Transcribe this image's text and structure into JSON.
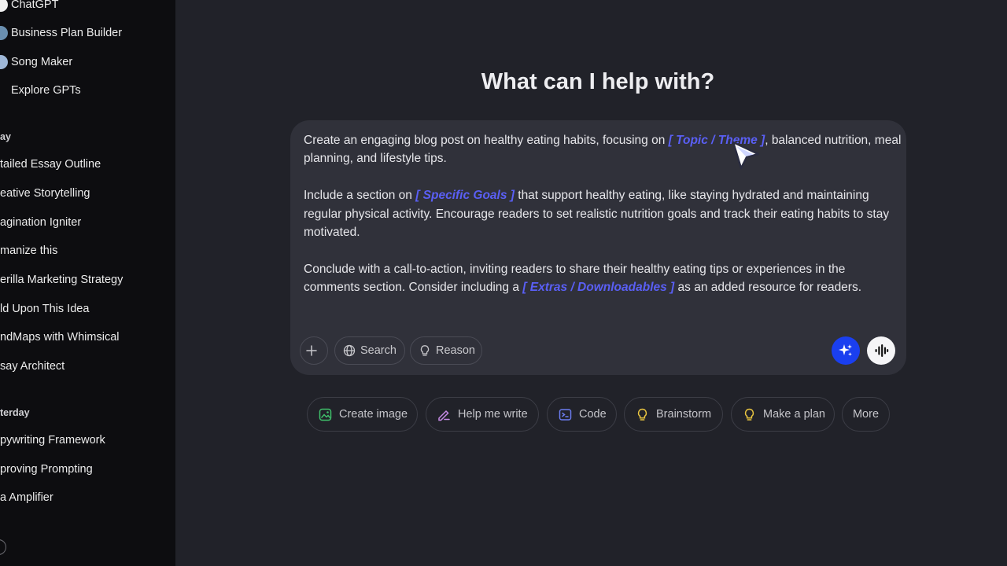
{
  "sidebar": {
    "gpts": [
      {
        "label": "ChatGPT",
        "color": "#f0f0f0"
      },
      {
        "label": "Business Plan Builder",
        "color": "#6a8fb0"
      },
      {
        "label": "Song Maker",
        "color": "#9fb8d8"
      },
      {
        "label": "Explore GPTs",
        "color": ""
      }
    ],
    "today_label": "ay",
    "today_items": [
      "tailed Essay Outline",
      "eative Storytelling",
      "agination Igniter",
      "manize this",
      "erilla Marketing Strategy",
      "ld Upon This Idea",
      "ndMaps with Whimsical",
      "say Architect"
    ],
    "yesterday_label": "terday",
    "yesterday_items": [
      "pywriting Framework",
      "proving Prompting",
      "a Amplifier"
    ]
  },
  "main": {
    "title": "What can I help with?",
    "prompt": {
      "p1_a": "Create an engaging blog post on healthy eating habits, focusing on ",
      "p1_var": "[ Topic / Theme ]",
      "p1_b": ", balanced nutrition, meal planning, and lifestyle tips.",
      "p2_a": "Include a section on ",
      "p2_var": "[ Specific Goals ]",
      "p2_b": " that support healthy eating, like staying hydrated and maintaining regular physical activity. Encourage readers to set realistic nutrition goals and track their eating habits to stay motivated.",
      "p3_a": "Conclude with a call-to-action, inviting readers to share their healthy eating tips or experiences in the comments section. Consider including a ",
      "p3_var": "[ Extras / Downloadables ]",
      "p3_b": " as an added resource for readers."
    },
    "tools": {
      "search_label": "Search",
      "reason_label": "Reason"
    },
    "suggestions": [
      {
        "label": "Create image",
        "icon": "image-icon",
        "color": "#3fbf6a"
      },
      {
        "label": "Help me write",
        "icon": "pen-icon",
        "color": "#c68ae6"
      },
      {
        "label": "Code",
        "icon": "terminal-icon",
        "color": "#6b7cf0"
      },
      {
        "label": "Brainstorm",
        "icon": "bulb-icon",
        "color": "#e8c440"
      },
      {
        "label": "Make a plan",
        "icon": "bulb-icon",
        "color": "#e8c440"
      },
      {
        "label": "More",
        "icon": "",
        "color": ""
      }
    ],
    "accent": "#1a3ff0",
    "variable_color": "#5a5ff5"
  }
}
